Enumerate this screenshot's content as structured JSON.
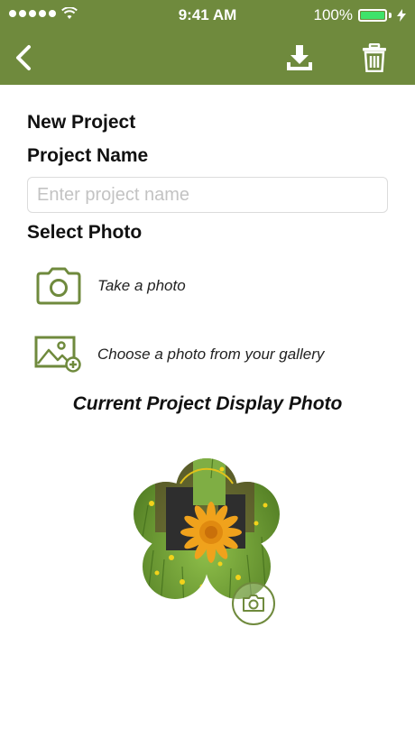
{
  "status_bar": {
    "time": "9:41 AM",
    "battery": "100%"
  },
  "nav": {
    "back_icon": "chevron-left-icon",
    "download_icon": "download-icon",
    "trash_icon": "trash-icon"
  },
  "form": {
    "title": "New Project",
    "project_name_label": "Project Name",
    "project_name_placeholder": "Enter project name",
    "project_name_value": "",
    "select_photo_label": "Select Photo",
    "take_photo_label": "Take a photo",
    "gallery_label": "Choose a photo from your gallery",
    "current_photo_heading": "Current Project Display Photo"
  },
  "colors": {
    "accent": "#6f8a3d",
    "icon_green": "#6f8a3d"
  }
}
